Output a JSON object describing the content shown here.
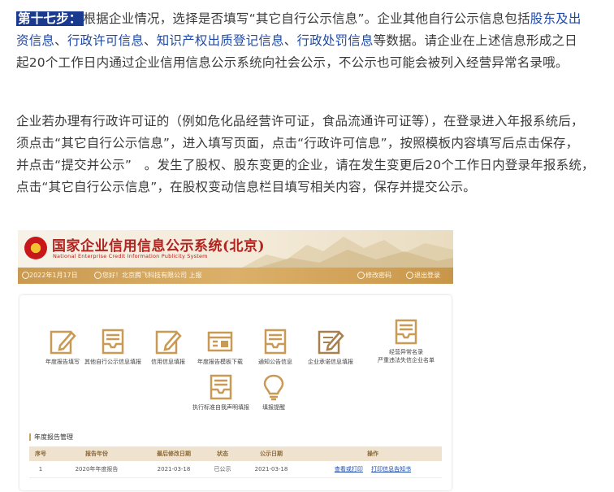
{
  "paragraph1": {
    "step_label": "第十七步：",
    "text_a": "根据企业情况，选择是否填写“其它自行公示信息”。企业其他自行公示信息包括",
    "link_a": "股东及出资信息",
    "sep_a": "、",
    "link_b": "行政许可信息",
    "sep_b": "、",
    "link_c": "知识产权出质登记信息",
    "sep_c": "、",
    "link_d": "行政处罚信息",
    "text_b": "等数据。请企业在上述信息形成之日起20个工作日内通过企业信用信息公示系统向社会公示，不公示也可能会被列入经营异常名录哦。"
  },
  "paragraph2": {
    "text": "企业若办理有行政许可证的（例如危化品经营许可证，食品流通许可证等），在登录进入年报系统后，须点击“其它自行公示信息”，进入填写页面，点击“行政许可信息”，按照模板内容填写后点击保存，并点击“提交并公示”　。发生了股权、股东变更的企业，请在发生变更后20个工作日内登录年报系统，　点击“其它自行公示信息”，在股权变动信息栏目填写相关内容，保存并提交公示。"
  },
  "screenshot": {
    "system_title": "国家企业信用信息公示系统(北京)",
    "system_subtitle": "National Enterprise Credit Information Publicity System",
    "bar_date": "2022年1月17日",
    "bar_user": "您好！北京腾飞科技有限公司 上报",
    "bar_change_password": "修改密码",
    "bar_logout": "退出登录",
    "tiles": [
      {
        "label": "年度报告填写",
        "icon": "edit-icon"
      },
      {
        "label": "其他自行公示信息填报",
        "icon": "inbox-icon"
      },
      {
        "label": "信用信息填报",
        "icon": "edit-icon"
      },
      {
        "label": "年度报告模板下载",
        "icon": "document-icon"
      },
      {
        "label": "通知公告信息",
        "icon": "inbox-icon"
      },
      {
        "label": "企业承诺信息填报",
        "icon": "edit-icon"
      },
      {
        "label": "经营异常名录",
        "label2": "严重违法失信企业名单",
        "icon": "inbox-icon"
      },
      {
        "label": "执行标准自我声明填报",
        "icon": "inbox-icon"
      },
      {
        "label": "填报提醒",
        "icon": "lightbulb-icon"
      }
    ],
    "section_title": "年度报告管理",
    "table": {
      "headers": [
        "序号",
        "报告年份",
        "最后修改日期",
        "状态",
        "公示日期",
        "操作"
      ],
      "rows": [
        {
          "no": "1",
          "year": "2020年年度报告",
          "modified": "2021-03-18",
          "status": "已公示",
          "published": "2021-03-18",
          "action1": "查看或打印",
          "action2": "打印信息告知书"
        }
      ]
    },
    "colors": {
      "brand_red": "#b0231f",
      "gold": "#c99a50",
      "link_blue": "#1f4aa8"
    }
  }
}
